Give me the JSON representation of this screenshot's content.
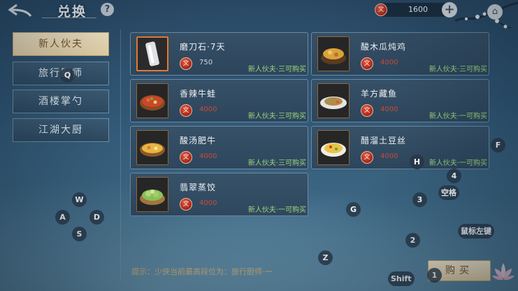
{
  "header": {
    "back_icon": "back-arrow-icon",
    "title": "兑换",
    "help_label": "?",
    "currency": {
      "icon": "copper-coin-icon",
      "value": "1600"
    },
    "plus_label": "+",
    "home_icon": "home-icon"
  },
  "categories": [
    {
      "label": "新人伙夫",
      "active": true
    },
    {
      "label": "旅行厨师",
      "active": false
    },
    {
      "label": "酒楼掌勺",
      "active": false
    },
    {
      "label": "江湖大厨",
      "active": false
    }
  ],
  "items": [
    {
      "name": "磨刀石·7天",
      "price": "750",
      "limit": "新人伙夫·三可购买",
      "selected": true,
      "icon": "whetstone-icon"
    },
    {
      "name": "酸木瓜炖鸡",
      "price": "4000",
      "limit": "新人伙夫·三可购买",
      "selected": false,
      "icon": "braised-chicken-icon"
    },
    {
      "name": "香辣牛蛙",
      "price": "4000",
      "limit": "新人伙夫·三可购买",
      "selected": false,
      "icon": "spicy-bullfrog-icon"
    },
    {
      "name": "羊方藏鱼",
      "price": "4000",
      "limit": "新人伙夫·一可购买",
      "selected": false,
      "icon": "lamb-fish-icon"
    },
    {
      "name": "酸汤肥牛",
      "price": "4000",
      "limit": "新人伙夫·三可购买",
      "selected": false,
      "icon": "sour-soup-beef-icon"
    },
    {
      "name": "醋溜土豆丝",
      "price": "4000",
      "limit": "新人伙夫·一可购买",
      "selected": false,
      "icon": "potato-shreds-icon"
    },
    {
      "name": "翡翠蒸饺",
      "price": "4000",
      "limit": "新人伙夫·一可购买",
      "selected": false,
      "icon": "jade-dumplings-icon"
    }
  ],
  "tip": "提示：少侠当前最高段位为：旅行厨师·一",
  "buy_label": "购买",
  "key_hints": {
    "q": "Q",
    "w": "W",
    "a": "A",
    "s": "S",
    "d": "D",
    "f": "F",
    "g": "G",
    "h": "H",
    "z": "Z",
    "n1": "1",
    "n2": "2",
    "n3": "3",
    "n4": "4",
    "space": "空格",
    "mouse_left": "鼠标左键",
    "shift": "Shift"
  },
  "colors": {
    "price_red": "#c84b36",
    "limit_green": "#9ed47a",
    "tab_active_bg": "#f8eac9",
    "tip_gold": "#d3b27c"
  }
}
